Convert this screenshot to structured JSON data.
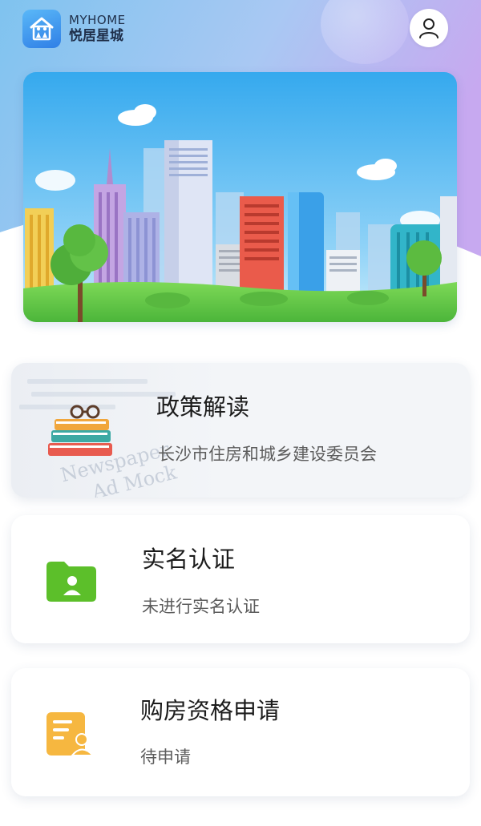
{
  "header": {
    "brand_en": "MYHOME",
    "brand_cn": "悦居星城",
    "logo_icon": "house-family-icon",
    "profile_icon": "user-icon"
  },
  "banner": {
    "illustration": "city-skyline-illustration"
  },
  "cards": [
    {
      "title": "政策解读",
      "subtitle": "长沙市住房和城乡建设委员会",
      "icon": "books-glasses-icon"
    },
    {
      "title": "实名认证",
      "subtitle": "未进行实名认证",
      "icon": "id-folder-icon"
    },
    {
      "title": "购房资格申请",
      "subtitle": "待申请",
      "icon": "application-form-icon"
    }
  ],
  "colors": {
    "accent_blue": "#2f7fe6",
    "green_icon": "#5cbf2a",
    "orange_icon": "#f6b740"
  }
}
